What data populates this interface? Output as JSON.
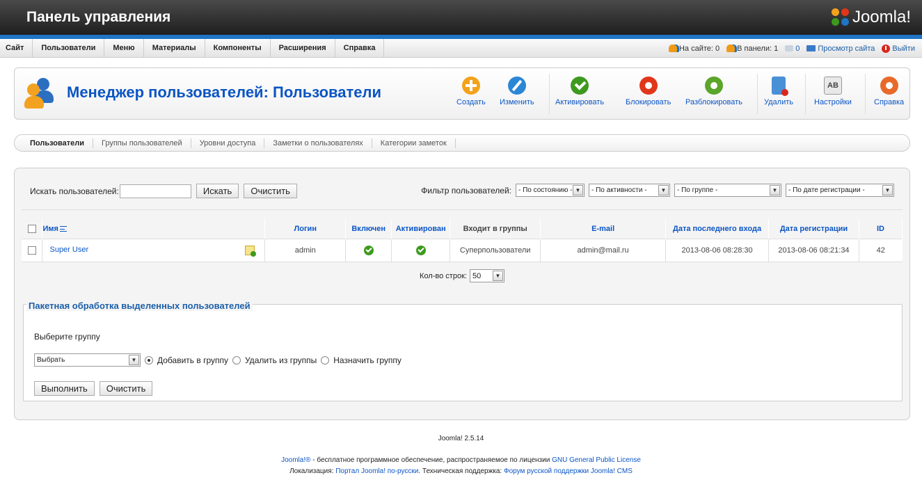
{
  "header": {
    "title": "Панель управления",
    "logo_text": "Joomla!"
  },
  "menu": [
    "Сайт",
    "Пользователи",
    "Меню",
    "Материалы",
    "Компоненты",
    "Расширения",
    "Справка"
  ],
  "status": {
    "on_site": "На сайте: 0",
    "in_panel": "В панели: 1",
    "messages": "0",
    "view_site": "Просмотр сайта",
    "logout": "Выйти"
  },
  "page_title": "Менеджер пользователей: Пользователи",
  "toolbar": {
    "create": "Создать",
    "edit": "Изменить",
    "activate": "Активировать",
    "block": "Блокировать",
    "unblock": "Разблокировать",
    "delete": "Удалить",
    "options": "Настройки",
    "options_icon_text": "AB",
    "help": "Справка"
  },
  "colors": {
    "accent": "#0b55c4",
    "green": "#3d9a1f",
    "orange": "#f3a21b",
    "red": "#e2361b",
    "blue": "#1f74c4"
  },
  "tabs": [
    "Пользователи",
    "Группы пользователей",
    "Уровни доступа",
    "Заметки о пользователях",
    "Категории заметок"
  ],
  "search": {
    "label": "Искать пользователей:",
    "value": "",
    "search_button": "Искать",
    "clear_button": "Очистить"
  },
  "filters": {
    "label": "Фильтр пользователей:",
    "state": "- По состоянию -",
    "active": "- По активности -",
    "group": "- По группе -",
    "registration": "- По дате регистрации -"
  },
  "table": {
    "headers": {
      "name": "Имя",
      "login": "Логин",
      "enabled": "Включен",
      "activated": "Активирован",
      "groups": "Входит в группы",
      "email": "E-mail",
      "last_visit": "Дата последнего входа",
      "registered": "Дата регистрации",
      "id": "ID"
    },
    "rows": [
      {
        "name": "Super User",
        "login": "admin",
        "groups": "Суперпользователи",
        "email": "admin@mail.ru",
        "last_visit": "2013-08-06 08:28:30",
        "registered": "2013-08-06 08:21:34",
        "id": "42"
      }
    ]
  },
  "pagination": {
    "label": "Кол-во строк:",
    "value": "50"
  },
  "batch": {
    "legend": "Пакетная обработка выделенных пользователей",
    "group_label": "Выберите группу",
    "select_value": "Выбрать",
    "add": "Добавить в группу",
    "remove": "Удалить из группы",
    "set": "Назначить группу",
    "submit": "Выполнить",
    "clear": "Очистить"
  },
  "footer": {
    "version": "Joomla! 2.5.14",
    "line1_link": "Joomla!®",
    "line1_text": " - бесплатное программное обеспечение, распространяемое по лицензии ",
    "line1_license": "GNU General Public License",
    "line2_text1": "Локализация: ",
    "line2_link1": "Портал Joomla! по-русски",
    "line2_text2": ". Техническая поддержка: ",
    "line2_link2": "Форум русской поддержки Joomla! CMS"
  }
}
